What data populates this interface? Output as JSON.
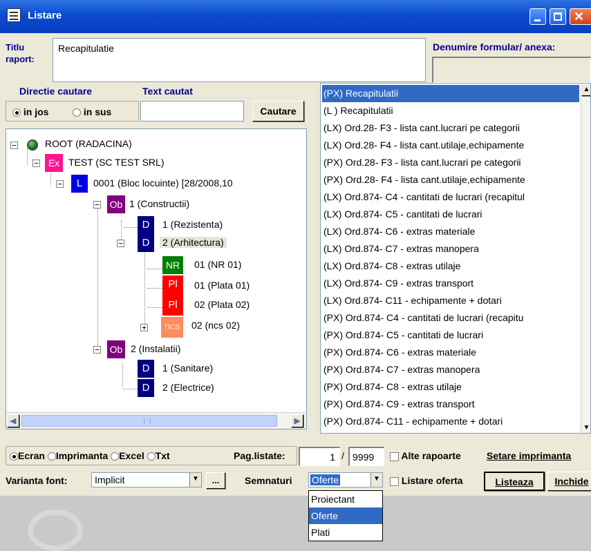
{
  "window": {
    "title": "Listare"
  },
  "header": {
    "titlu_label_line1": "Titlu",
    "titlu_label_line2": "raport:",
    "titlu_value": "Recapitulatie",
    "denumire_label": "Denumire formular/ anexa:",
    "denumire_value": ""
  },
  "search": {
    "directie_label": "Directie cautare",
    "text_label": "Text cautat",
    "radio_jos": "in jos",
    "radio_sus": "in sus",
    "text_value": "",
    "button_label": "Cautare"
  },
  "tree": {
    "root": {
      "label": "ROOT (RADACINA)"
    },
    "ex": {
      "badge": "Ex",
      "label": "TEST (SC TEST SRL)"
    },
    "l": {
      "badge": "L",
      "label": "0001 (Bloc locuinte) [28/2008,10"
    },
    "ob1": {
      "badge": "Ob",
      "label": "1 (Constructii)"
    },
    "d1": {
      "badge": "D",
      "label": "1 (Rezistenta)"
    },
    "d2": {
      "badge": "D",
      "label": "2 (Arhitectura)"
    },
    "nr": {
      "badge": "NR",
      "label": "01 (NR 01)"
    },
    "pl1": {
      "badge": "Pl",
      "label": "01 (Plata 01)"
    },
    "pl2": {
      "badge": "Pl",
      "label": "02 (Plata 02)"
    },
    "ncs": {
      "badge": "ncs",
      "label": "02 (ncs 02)"
    },
    "ob2": {
      "badge": "Ob",
      "label": "2 (Instalatii)"
    },
    "d3": {
      "badge": "D",
      "label": "1 (Sanitare)"
    },
    "d4": {
      "badge": "D",
      "label": "2 (Electrice)"
    }
  },
  "reports": [
    "(PX) Recapitulatii",
    "(L ) Recapitulatii",
    "(LX) Ord.28- F3 - lista cant.lucrari pe categorii",
    "(LX) Ord.28- F4 - lista cant.utilaje,echipamente",
    "(PX) Ord.28- F3 - lista cant.lucrari pe categorii",
    "(PX) Ord.28- F4 - lista cant.utilaje,echipamente",
    "(LX) Ord.874- C4 - cantitati de lucrari (recapitul",
    "(LX) Ord.874- C5 - cantitati de lucrari",
    "(LX) Ord.874- C6 - extras materiale",
    "(LX) Ord.874- C7 - extras manopera",
    "(LX) Ord.874- C8 - extras utilaje",
    "(LX) Ord.874- C9 - extras transport",
    "(LX) Ord.874- C11 - echipamente + dotari",
    "(PX) Ord.874- C4 - cantitati de lucrari (recapitu",
    "(PX) Ord.874- C5 - cantitati de lucrari",
    "(PX) Ord.874- C6 - extras materiale",
    "(PX) Ord.874- C7 - extras manopera",
    "(PX) Ord.874- C8 - extras utilaje",
    "(PX) Ord.874- C9 - extras transport",
    "(PX) Ord.874- C11 - echipamente + dotari"
  ],
  "output": {
    "ecran": "Ecran",
    "imprimanta": "Imprimanta",
    "excel": "Excel",
    "txt": "Txt",
    "pag_label": "Pag.listate:",
    "pag_from": "1",
    "pag_sep": "/",
    "pag_to": "9999",
    "alte_rapoarte": "Alte rapoarte",
    "setare_imprimanta": "Setare imprimanta"
  },
  "bottom": {
    "varianta_label": "Varianta font:",
    "varianta_value": "Implicit",
    "ellipsis": "...",
    "semnaturi_label": "Semnaturi",
    "semnaturi_value": "Oferte",
    "listare_oferta": "Listare oferta",
    "listeaza": "Listeaza",
    "inchide": "Inchide"
  },
  "dropdown_options": [
    "Proiectant",
    "Oferte",
    "Plati"
  ]
}
